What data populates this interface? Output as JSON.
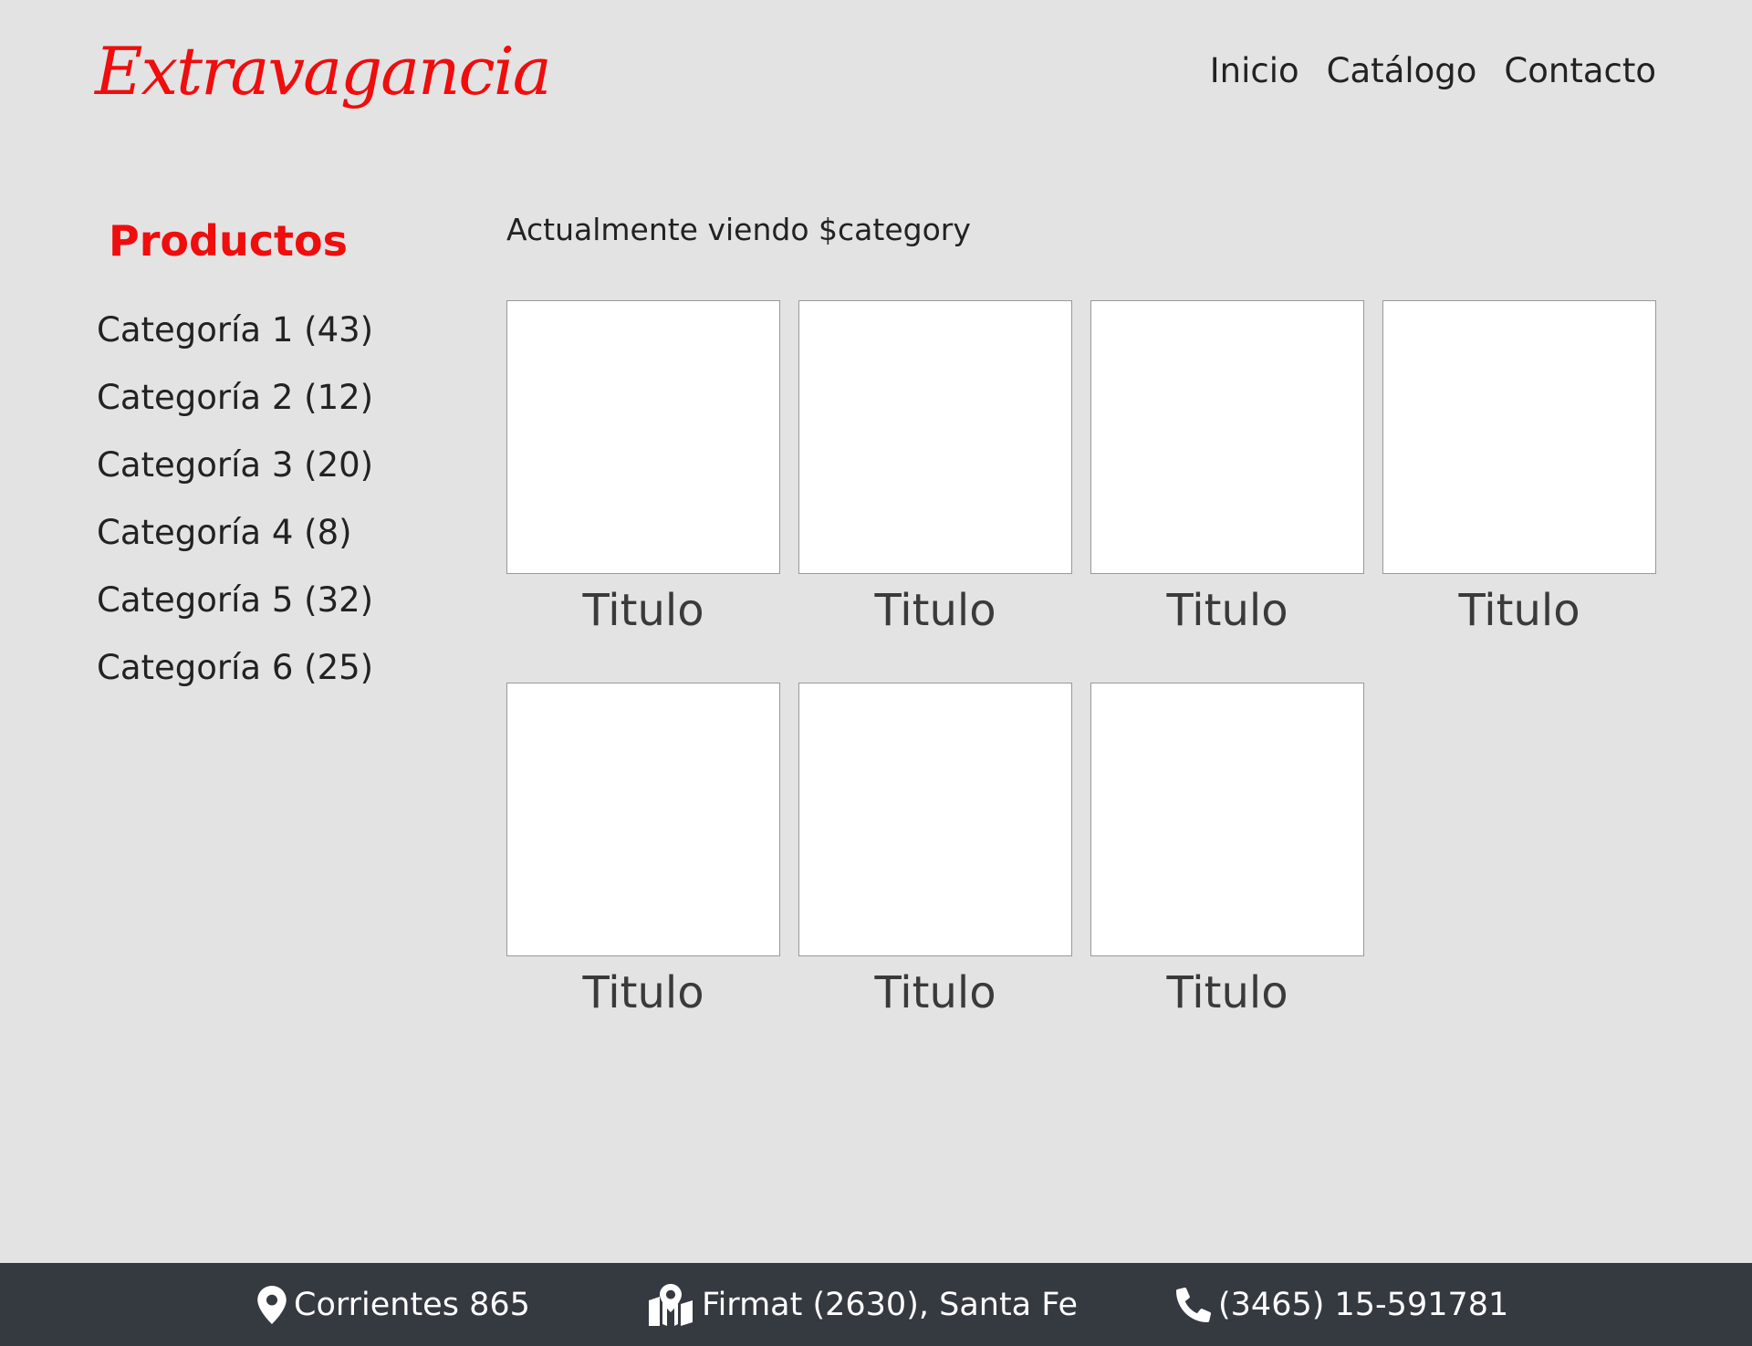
{
  "header": {
    "logo_text": "Extravagancia",
    "nav": [
      "Inicio",
      "Catálogo",
      "Contacto"
    ]
  },
  "sidebar": {
    "title": "Productos",
    "categories": [
      "Categoría 1 (43)",
      "Categoría 2 (12)",
      "Categoría 3 (20)",
      "Categoría 4 (8)",
      "Categoría 5 (32)",
      "Categoría 6 (25)"
    ]
  },
  "main": {
    "current_view_text": "Actualmente viendo $category",
    "products": [
      {
        "title": "Titulo"
      },
      {
        "title": "Titulo"
      },
      {
        "title": "Titulo"
      },
      {
        "title": "Titulo"
      },
      {
        "title": "Titulo"
      },
      {
        "title": "Titulo"
      },
      {
        "title": "Titulo"
      }
    ]
  },
  "footer": {
    "address": "Corrientes 865",
    "address_icon": "map-pin-icon",
    "city": "Firmat (2630), Santa Fe",
    "city_icon": "map-icon",
    "phone": "(3465) 15-591781",
    "phone_icon": "phone-icon"
  },
  "colors": {
    "brand": "#ef0d0d",
    "background": "#e3e3e3",
    "footer_background": "#353940",
    "footer_text": "#ffffff",
    "card_background": "#ffffff",
    "card_border": "#999999"
  }
}
